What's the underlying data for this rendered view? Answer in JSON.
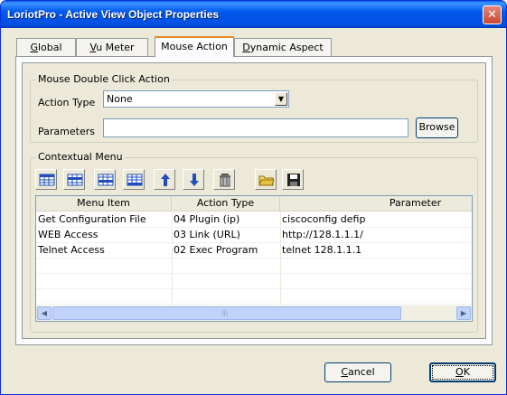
{
  "window": {
    "title": "LoriotPro - Active View Object Properties",
    "close_glyph": "✕"
  },
  "tabs": [
    {
      "label": "Global",
      "mnemonic": "G",
      "rest": "lobal",
      "active": false
    },
    {
      "label": "Vu Meter",
      "mnemonic": "V",
      "rest": "u Meter",
      "active": false
    },
    {
      "label": "Mouse Action",
      "mnemonic": "",
      "rest": "Mouse Action",
      "active": true
    },
    {
      "label": "Dynamic Aspect",
      "mnemonic": "D",
      "rest": "ynamic Aspect",
      "active": false
    }
  ],
  "double_click": {
    "group_title": "Mouse Double Click Action",
    "action_type_label": "Action Type",
    "action_type_value": "None",
    "parameters_label": "Parameters",
    "parameters_value": "",
    "browse_label": "Browse"
  },
  "contextual_menu": {
    "group_title": "Contextual Menu",
    "toolbar_icons": [
      "insert-row-icon",
      "add-row-icon",
      "edit-row-icon",
      "delete-row-icon",
      "move-up-icon",
      "move-down-icon",
      "delete-icon",
      "open-folder-icon",
      "save-icon"
    ],
    "columns": [
      "Menu Item",
      "Action Type",
      "Parameter"
    ],
    "rows": [
      [
        "Get Configuration File",
        "04 Plugin (ip)",
        "ciscoconfig  defip"
      ],
      [
        "WEB Access",
        "03 Link (URL)",
        "http://128.1.1.1/"
      ],
      [
        "Telnet Access",
        "02 Exec Program",
        "telnet 128.1.1.1"
      ]
    ],
    "scroll_left_glyph": "◀",
    "scroll_right_glyph": "▶",
    "scroll_grip_glyph": "|||"
  },
  "footer": {
    "cancel_label": "Cancel",
    "ok_label": "OK"
  },
  "colors": {
    "titlebar": "#0054e3",
    "dialog_bg": "#ece9d8",
    "accent_tab": "#e68b2c",
    "toolbar_blue": "#1f4fbf"
  }
}
